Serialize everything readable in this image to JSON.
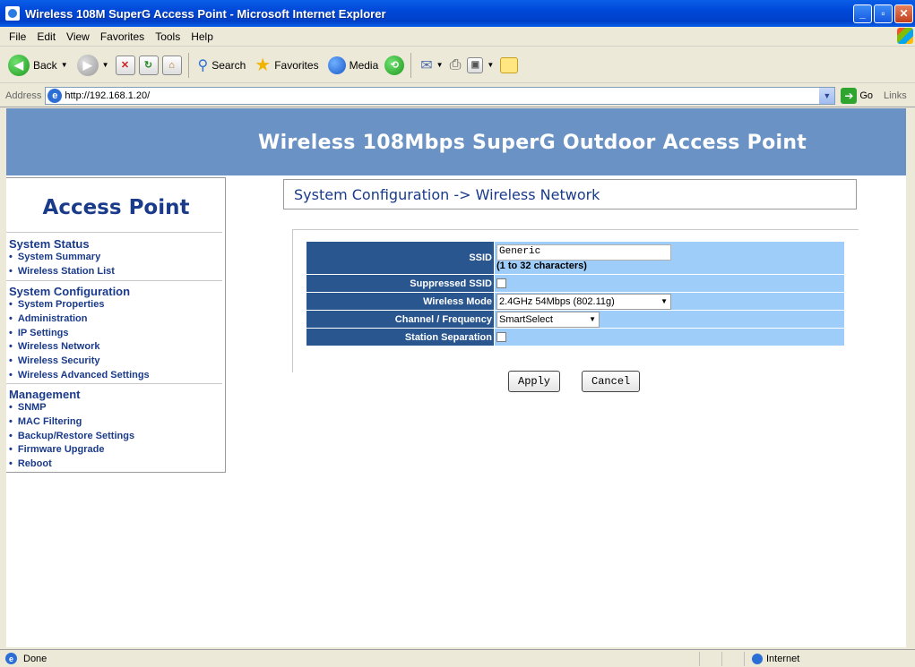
{
  "window": {
    "title": "Wireless 108M SuperG Access Point - Microsoft Internet Explorer",
    "minimize": "_",
    "maximize": "▫",
    "close": "✕"
  },
  "menubar": [
    "File",
    "Edit",
    "View",
    "Favorites",
    "Tools",
    "Help"
  ],
  "toolbar": {
    "back_label": "Back",
    "search_label": "Search",
    "favorites_label": "Favorites",
    "media_label": "Media"
  },
  "address": {
    "label": "Address",
    "url": "http://192.168.1.20/",
    "go_label": "Go",
    "links_label": "Links"
  },
  "page": {
    "banner_title": "Wireless 108Mbps SuperG Outdoor Access Point",
    "sidebar_title": "Access Point",
    "sections": [
      {
        "header": "System Status",
        "items": [
          "System Summary",
          "Wireless Station List"
        ]
      },
      {
        "header": "System Configuration",
        "items": [
          "System Properties",
          "Administration",
          "IP Settings",
          "Wireless Network",
          "Wireless Security",
          "Wireless Advanced Settings"
        ]
      },
      {
        "header": "Management",
        "items": [
          "SNMP",
          "MAC Filtering",
          "Backup/Restore Settings",
          "Firmware Upgrade",
          "Reboot"
        ]
      }
    ],
    "section_title": "System Configuration -> Wireless Network",
    "form": {
      "ssid_label": "SSID",
      "ssid_value": "Generic",
      "ssid_hint": "(1 to 32 characters)",
      "suppressed_ssid_label": "Suppressed SSID",
      "suppressed_ssid_checked": false,
      "wireless_mode_label": "Wireless Mode",
      "wireless_mode_value": "2.4GHz 54Mbps (802.11g)",
      "channel_label": "Channel / Frequency",
      "channel_value": "SmartSelect",
      "station_separation_label": "Station Separation",
      "station_separation_checked": false
    },
    "buttons": {
      "apply": "Apply",
      "cancel": "Cancel"
    }
  },
  "statusbar": {
    "status": "Done",
    "zone": "Internet"
  }
}
